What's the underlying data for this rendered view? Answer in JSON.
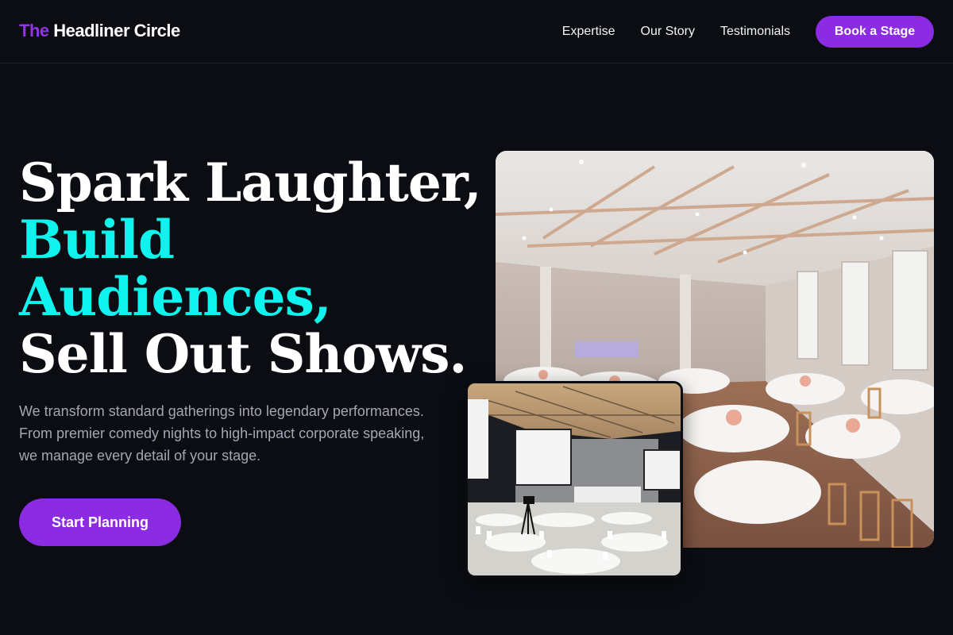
{
  "brand": {
    "accent": "The",
    "rest": "Headliner Circle"
  },
  "nav": {
    "links": [
      "Expertise",
      "Our Story",
      "Testimonials"
    ],
    "cta": "Book a Stage"
  },
  "hero": {
    "line1": "Spark Laughter,",
    "line2": "Build",
    "line3": "Audiences,",
    "line4": "Sell Out Shows.",
    "subtext": "We transform standard gatherings into legendary performances. From premier comedy nights to high-impact corporate speaking, we manage every detail of your stage.",
    "cta": "Start Planning"
  },
  "colors": {
    "background": "#0b0d13",
    "accent_purple": "#8b2be2",
    "accent_cyan": "#0ff3ee",
    "muted_text": "#a3a7b3"
  },
  "images": {
    "main": "banquet-hall-photo",
    "inset": "conference-hall-photo"
  }
}
